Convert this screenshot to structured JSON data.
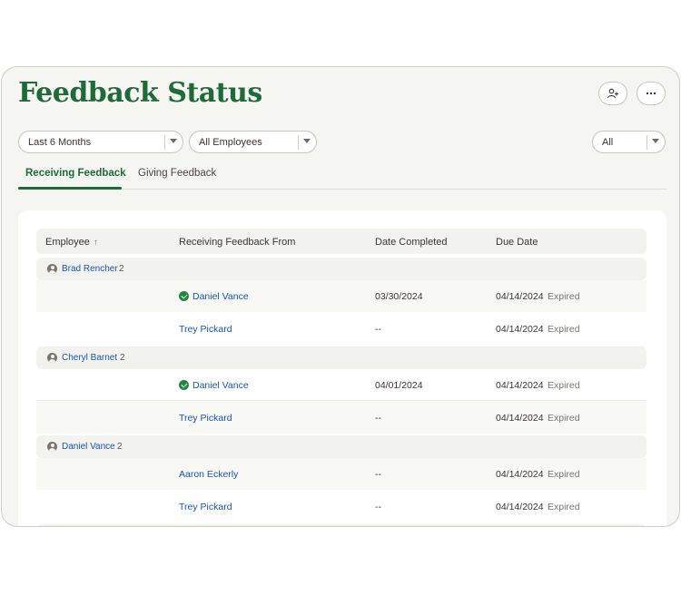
{
  "header": {
    "title": "Feedback Status",
    "add_person_icon": "add-person-icon",
    "more_icon": "ellipsis-icon"
  },
  "filters": {
    "period": {
      "value": "Last 6 Months"
    },
    "employees": {
      "value": "All Employees"
    },
    "status": {
      "value": "All"
    }
  },
  "tabs": [
    {
      "label": "Receiving Feedback",
      "active": true
    },
    {
      "label": "Giving Feedback",
      "active": false
    }
  ],
  "table": {
    "columns": [
      "Employee",
      "Receiving Feedback From",
      "Date Completed",
      "Due Date"
    ],
    "sort_icon": "arrow-up-icon",
    "groups": [
      {
        "employee": "Brad Rencher",
        "count": "2",
        "rows": [
          {
            "reviewer": "Daniel Vance",
            "completed_check": true,
            "date_completed": "03/30/2024",
            "due_date": "04/14/2024",
            "status": "Expired"
          },
          {
            "reviewer": "Trey Pickard",
            "completed_check": false,
            "date_completed": "--",
            "due_date": "04/14/2024",
            "status": "Expired"
          }
        ]
      },
      {
        "employee": "Cheryl Barnet",
        "count": "2",
        "rows": [
          {
            "reviewer": "Daniel Vance",
            "completed_check": true,
            "date_completed": "04/01/2024",
            "due_date": "04/14/2024",
            "status": "Expired"
          },
          {
            "reviewer": "Trey Pickard",
            "completed_check": false,
            "date_completed": "--",
            "due_date": "04/14/2024",
            "status": "Expired"
          }
        ]
      },
      {
        "employee": "Daniel Vance",
        "count": "2",
        "rows": [
          {
            "reviewer": "Aaron Eckerly",
            "completed_check": false,
            "date_completed": "--",
            "due_date": "04/14/2024",
            "status": "Expired"
          },
          {
            "reviewer": "Trey Pickard",
            "completed_check": false,
            "date_completed": "--",
            "due_date": "04/14/2024",
            "status": "Expired"
          }
        ]
      }
    ]
  },
  "colors": {
    "brand_green": "#1e6b3a",
    "link_blue": "#1b52b8",
    "check_green": "#1f8a3e"
  }
}
